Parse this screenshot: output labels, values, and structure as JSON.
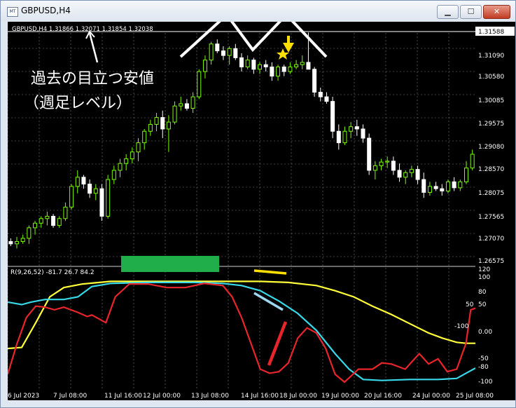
{
  "window": {
    "title": "GBPUSD,H4",
    "icon_text": "MT"
  },
  "controls": {
    "minimize": "▁",
    "maximize": "☐",
    "close": "✕"
  },
  "chart_header": {
    "text": "GBPUSD,H4  1.31866 1.32071 1.31854 1.32038"
  },
  "current_price": "1.31588",
  "price_labels": [
    "1.31090",
    "1.30580",
    "1.30085",
    "1.29575",
    "1.29080",
    "1.28570",
    "1.28075",
    "1.27565",
    "1.27070",
    "1.26575"
  ],
  "indicator": {
    "header": "R(9,26,52) -81.7 26.7 84.2",
    "scale_labels": [
      "120",
      "100",
      "80",
      "50",
      "0.00",
      "-50",
      "-80",
      "-100"
    ],
    "mid_label_right": "-100",
    "mid_label_50": "50"
  },
  "time_labels": [
    "6 Jul 2023",
    "7 Jul 08:00",
    "11 Jul 16:00",
    "12 Jul 00:00",
    "13 Jul 08:00",
    "14 Jul 16:00",
    "18 Jul 00:00",
    "19 Jul 00:00",
    "20 Jul 16:00",
    "24 Jul 00:00",
    "25 Jul 08:00"
  ],
  "annotations": {
    "line1": "過去の目立つ安値",
    "line2": "（週足レベル）"
  },
  "colors": {
    "bull": "#7CFC00",
    "bear": "#ffffff",
    "red": "#e8252b",
    "cyan": "#38d8e8",
    "yellow": "#ffff3a",
    "green_box": "#1fae4a",
    "arrow": "#ffe000"
  },
  "chart_data": {
    "type": "candlestick",
    "price_axis": {
      "min": 1.2657,
      "max": 1.3159
    },
    "candles": [
      [
        1.2705,
        1.2712,
        1.2695,
        1.27
      ],
      [
        1.27,
        1.2715,
        1.269,
        1.2705
      ],
      [
        1.2705,
        1.272,
        1.27,
        1.2712
      ],
      [
        1.2712,
        1.274,
        1.27,
        1.2735
      ],
      [
        1.2735,
        1.275,
        1.272,
        1.2745
      ],
      [
        1.2745,
        1.276,
        1.2735,
        1.2755
      ],
      [
        1.2755,
        1.277,
        1.274,
        1.276
      ],
      [
        1.276,
        1.2765,
        1.2735,
        1.274
      ],
      [
        1.274,
        1.276,
        1.2735,
        1.2755
      ],
      [
        1.2755,
        1.279,
        1.275,
        1.278
      ],
      [
        1.278,
        1.283,
        1.2775,
        1.2825
      ],
      [
        1.2825,
        1.286,
        1.281,
        1.2845
      ],
      [
        1.2845,
        1.285,
        1.282,
        1.283
      ],
      [
        1.283,
        1.284,
        1.28,
        1.281
      ],
      [
        1.281,
        1.283,
        1.2795,
        1.282
      ],
      [
        1.282,
        1.283,
        1.275,
        1.276
      ],
      [
        1.276,
        1.285,
        1.2755,
        1.284
      ],
      [
        1.284,
        1.287,
        1.283,
        1.286
      ],
      [
        1.286,
        1.2885,
        1.2845,
        1.2875
      ],
      [
        1.2875,
        1.2895,
        1.286,
        1.2885
      ],
      [
        1.2885,
        1.291,
        1.2875,
        1.29
      ],
      [
        1.29,
        1.293,
        1.288,
        1.292
      ],
      [
        1.292,
        1.295,
        1.2905,
        1.2945
      ],
      [
        1.2945,
        1.297,
        1.2935,
        1.296
      ],
      [
        1.296,
        1.2985,
        1.2945,
        1.2975
      ],
      [
        1.2975,
        1.299,
        1.293,
        1.295
      ],
      [
        1.295,
        1.298,
        1.29,
        1.2965
      ],
      [
        1.2965,
        1.301,
        1.296,
        1.3
      ],
      [
        1.3,
        1.302,
        1.299,
        1.3005
      ],
      [
        1.3005,
        1.3015,
        1.299,
        1.2995
      ],
      [
        1.2995,
        1.303,
        1.2985,
        1.302
      ],
      [
        1.302,
        1.308,
        1.3015,
        1.3075
      ],
      [
        1.3075,
        1.311,
        1.306,
        1.31
      ],
      [
        1.31,
        1.314,
        1.309,
        1.3135
      ],
      [
        1.3135,
        1.3145,
        1.3115,
        1.312
      ],
      [
        1.312,
        1.313,
        1.31,
        1.311
      ],
      [
        1.311,
        1.313,
        1.309,
        1.3125
      ],
      [
        1.3125,
        1.3135,
        1.31,
        1.3105
      ],
      [
        1.3105,
        1.3115,
        1.3075,
        1.3085
      ],
      [
        1.3085,
        1.311,
        1.308,
        1.31
      ],
      [
        1.31,
        1.3105,
        1.307,
        1.308
      ],
      [
        1.308,
        1.3095,
        1.307,
        1.309
      ],
      [
        1.309,
        1.31,
        1.3075,
        1.3085
      ],
      [
        1.3085,
        1.3095,
        1.3055,
        1.3065
      ],
      [
        1.3065,
        1.309,
        1.3055,
        1.3085
      ],
      [
        1.3085,
        1.309,
        1.3065,
        1.3075
      ],
      [
        1.3075,
        1.3095,
        1.307,
        1.3085
      ],
      [
        1.3085,
        1.31,
        1.308,
        1.309
      ],
      [
        1.309,
        1.311,
        1.308,
        1.3095
      ],
      [
        1.3095,
        1.316,
        1.3085,
        1.308
      ],
      [
        1.308,
        1.3085,
        1.302,
        1.303
      ],
      [
        1.303,
        1.304,
        1.301,
        1.302
      ],
      [
        1.302,
        1.303,
        1.3005,
        1.301
      ],
      [
        1.301,
        1.302,
        1.293,
        1.2945
      ],
      [
        1.2945,
        1.296,
        1.2905,
        1.292
      ],
      [
        1.292,
        1.2955,
        1.2915,
        1.2945
      ],
      [
        1.2945,
        1.2965,
        1.293,
        1.2955
      ],
      [
        1.2955,
        1.297,
        1.2935,
        1.295
      ],
      [
        1.295,
        1.296,
        1.292,
        1.293
      ],
      [
        1.293,
        1.294,
        1.285,
        1.286
      ],
      [
        1.286,
        1.288,
        1.284,
        1.287
      ],
      [
        1.287,
        1.2885,
        1.286,
        1.2878
      ],
      [
        1.2878,
        1.289,
        1.2865,
        1.288
      ],
      [
        1.288,
        1.289,
        1.285,
        1.286
      ],
      [
        1.286,
        1.2875,
        1.2835,
        1.2845
      ],
      [
        1.2845,
        1.286,
        1.283,
        1.2855
      ],
      [
        1.2855,
        1.287,
        1.2845,
        1.2862
      ],
      [
        1.2862,
        1.287,
        1.283,
        1.284
      ],
      [
        1.284,
        1.2855,
        1.28,
        1.2812
      ],
      [
        1.2812,
        1.2835,
        1.2805,
        1.2825
      ],
      [
        1.2825,
        1.2835,
        1.2815,
        1.282
      ],
      [
        1.282,
        1.283,
        1.2805,
        1.2815
      ],
      [
        1.2815,
        1.284,
        1.281,
        1.2835
      ],
      [
        1.2835,
        1.2845,
        1.2815,
        1.2822
      ],
      [
        1.2822,
        1.284,
        1.2815,
        1.2835
      ],
      [
        1.2835,
        1.288,
        1.283,
        1.2865
      ],
      [
        1.2865,
        1.2905,
        1.286,
        1.2895
      ]
    ],
    "indicator_axis": {
      "min": -110,
      "max": 125
    }
  }
}
